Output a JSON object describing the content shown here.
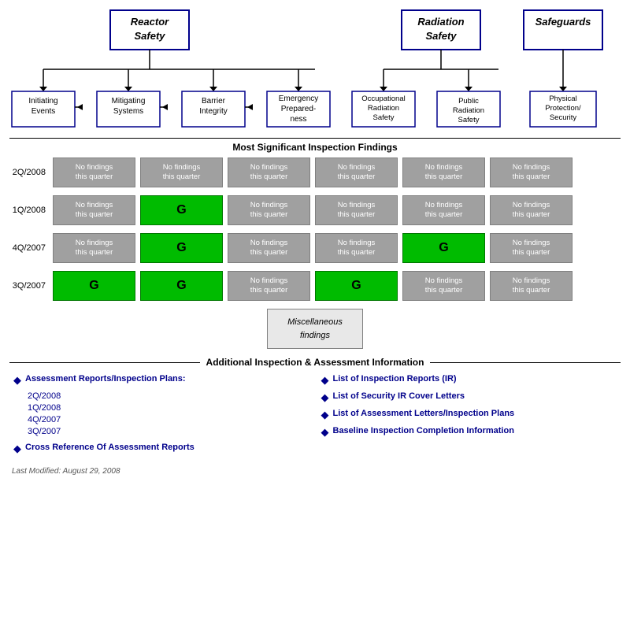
{
  "header": {
    "reactor_safety": "Reactor\nSafety",
    "radiation_safety": "Radiation\nSafety",
    "safeguards": "Safeguards"
  },
  "categories": [
    {
      "label": "Initiating\nEvents"
    },
    {
      "label": "Mitigating\nSystems"
    },
    {
      "label": "Barrier\nIntegrity"
    },
    {
      "label": "Emergency\nPreparedness"
    },
    {
      "label": "Occupational\nRadiation\nSafety"
    },
    {
      "label": "Public\nRadiation\nSafety"
    },
    {
      "label": "Physical\nProtection/\nSecurity"
    }
  ],
  "findings_title": "Most Significant Inspection Findings",
  "rows": [
    {
      "quarter": "2Q/2008",
      "cells": [
        {
          "type": "gray",
          "text": "No findings\nthis quarter"
        },
        {
          "type": "gray",
          "text": "No findings\nthis quarter"
        },
        {
          "type": "gray",
          "text": "No findings\nthis quarter"
        },
        {
          "type": "gray",
          "text": "No findings\nthis quarter"
        },
        {
          "type": "gray",
          "text": "No findings\nthis quarter"
        },
        {
          "type": "gray",
          "text": "No findings\nthis quarter"
        }
      ]
    },
    {
      "quarter": "1Q/2008",
      "cells": [
        {
          "type": "gray",
          "text": "No findings\nthis quarter"
        },
        {
          "type": "green",
          "text": "G"
        },
        {
          "type": "gray",
          "text": "No findings\nthis quarter"
        },
        {
          "type": "gray",
          "text": "No findings\nthis quarter"
        },
        {
          "type": "gray",
          "text": "No findings\nthis quarter"
        },
        {
          "type": "gray",
          "text": "No findings\nthis quarter"
        }
      ]
    },
    {
      "quarter": "4Q/2007",
      "cells": [
        {
          "type": "gray",
          "text": "No findings\nthis quarter"
        },
        {
          "type": "green",
          "text": "G"
        },
        {
          "type": "gray",
          "text": "No findings\nthis quarter"
        },
        {
          "type": "gray",
          "text": "No findings\nthis quarter"
        },
        {
          "type": "green",
          "text": "G"
        },
        {
          "type": "gray",
          "text": "No findings\nthis quarter"
        }
      ]
    },
    {
      "quarter": "3Q/2007",
      "cells": [
        {
          "type": "green",
          "text": "G"
        },
        {
          "type": "green",
          "text": "G"
        },
        {
          "type": "gray",
          "text": "No findings\nthis quarter"
        },
        {
          "type": "green",
          "text": "G"
        },
        {
          "type": "gray",
          "text": "No findings\nthis quarter"
        },
        {
          "type": "gray",
          "text": "No findings\nthis quarter"
        }
      ]
    }
  ],
  "misc_box": {
    "line1": "Miscellaneous",
    "line2": "findings"
  },
  "additional_title": "Additional Inspection & Assessment Information",
  "left_col": {
    "header": "Assessment Reports/Inspection Plans:",
    "links": [
      "2Q/2008",
      "1Q/2008",
      "4Q/2007",
      "3Q/2007"
    ],
    "cross_ref": "Cross Reference Of Assessment Reports"
  },
  "right_col": {
    "links": [
      "List of Inspection Reports (IR)",
      "List of Security IR Cover Letters",
      "List of Assessment Letters/Inspection Plans",
      "Baseline Inspection Completion Information"
    ]
  },
  "footer": "Last Modified:  August 29, 2008"
}
